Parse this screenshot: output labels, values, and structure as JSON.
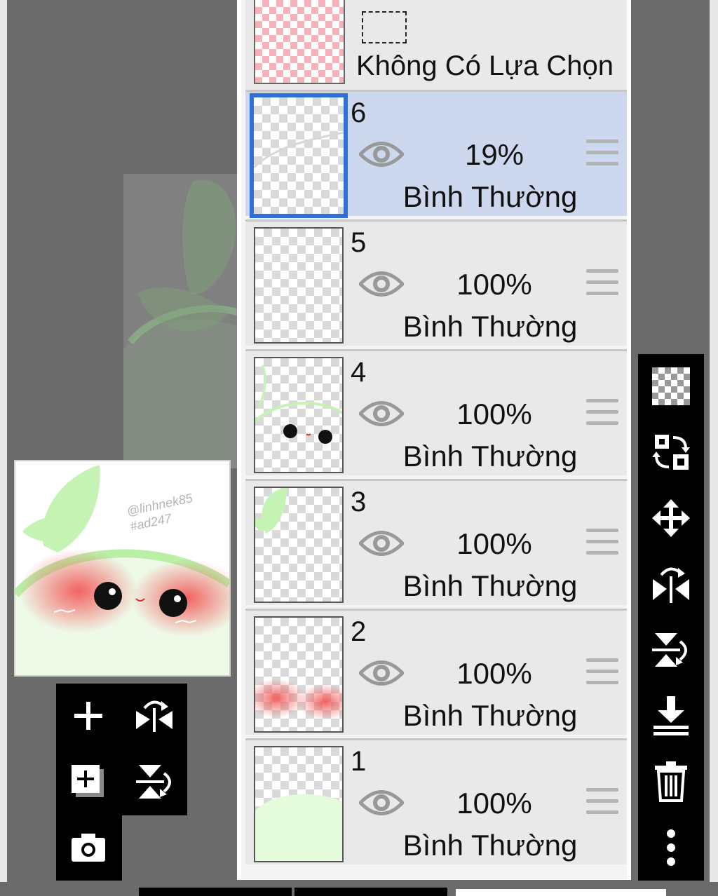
{
  "selection": {
    "label": "Không Có Lựa Chọn"
  },
  "layers": [
    {
      "number": "6",
      "opacity": "19%",
      "blend": "Bình Thường",
      "selected": true
    },
    {
      "number": "5",
      "opacity": "100%",
      "blend": "Bình Thường",
      "selected": false
    },
    {
      "number": "4",
      "opacity": "100%",
      "blend": "Bình Thường",
      "selected": false
    },
    {
      "number": "3",
      "opacity": "100%",
      "blend": "Bình Thường",
      "selected": false
    },
    {
      "number": "2",
      "opacity": "100%",
      "blend": "Bình Thường",
      "selected": false
    },
    {
      "number": "1",
      "opacity": "100%",
      "blend": "Bình Thường",
      "selected": false
    }
  ],
  "preview": {
    "watermark": "@linhnek85 #ad247"
  },
  "left_tools": [
    "add-layer-icon",
    "flip-horizontal-icon",
    "add-copy-layer-icon",
    "flip-vertical-icon",
    "camera-icon"
  ],
  "right_tools": [
    "transparency-icon",
    "swap-layer-icon",
    "move-icon",
    "flip-horizontal-icon",
    "flip-vertical-icon",
    "merge-down-icon",
    "trash-icon",
    "more-icon"
  ],
  "colors": {
    "selected_row": "#cdd8ee",
    "selected_border": "#2f6fd6",
    "leaf_green": "#b8f0a8",
    "blush": "#f46a6a"
  }
}
